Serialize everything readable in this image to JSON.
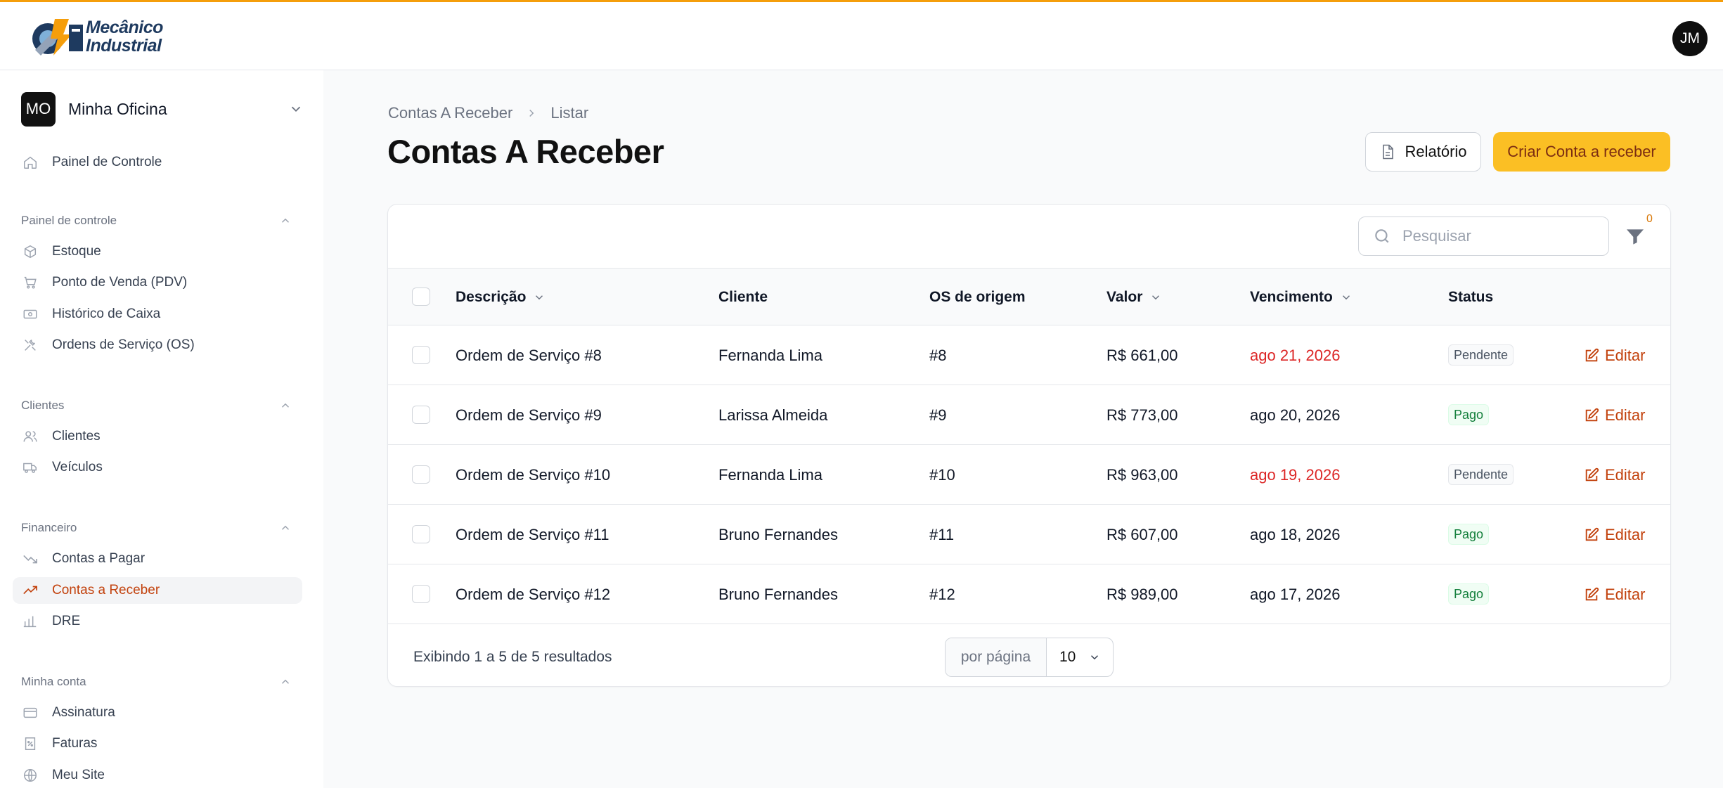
{
  "brand": {
    "line1": "Mecânico",
    "line2": "Industrial"
  },
  "user": {
    "initials": "JM"
  },
  "tenant": {
    "initials": "MO",
    "name": "Minha Oficina"
  },
  "sidebar": {
    "dashboard": "Painel de Controle",
    "groups": [
      {
        "label": "Painel de controle",
        "items": [
          "Estoque",
          "Ponto de Venda (PDV)",
          "Histórico de Caixa",
          "Ordens de Serviço (OS)"
        ]
      },
      {
        "label": "Clientes",
        "items": [
          "Clientes",
          "Veículos"
        ]
      },
      {
        "label": "Financeiro",
        "items": [
          "Contas a Pagar",
          "Contas a Receber",
          "DRE"
        ]
      },
      {
        "label": "Minha conta",
        "items": [
          "Assinatura",
          "Faturas",
          "Meu Site"
        ]
      }
    ],
    "active_item": "Contas a Receber"
  },
  "breadcrumb": {
    "parent": "Contas A Receber",
    "current": "Listar"
  },
  "page": {
    "title": "Contas A Receber"
  },
  "actions": {
    "report": "Relatório",
    "create": "Criar Conta a receber"
  },
  "search": {
    "placeholder": "Pesquisar"
  },
  "filter": {
    "count": "0"
  },
  "table": {
    "columns": [
      "Descrição",
      "Cliente",
      "OS de origem",
      "Valor",
      "Vencimento",
      "Status"
    ],
    "edit_label": "Editar",
    "rows": [
      {
        "descricao": "Ordem de Serviço #8",
        "cliente": "Fernanda Lima",
        "os": "#8",
        "valor": "R$ 661,00",
        "vencimento": "ago 21, 2026",
        "status": "Pendente"
      },
      {
        "descricao": "Ordem de Serviço #9",
        "cliente": "Larissa Almeida",
        "os": "#9",
        "valor": "R$ 773,00",
        "vencimento": "ago 20, 2026",
        "status": "Pago"
      },
      {
        "descricao": "Ordem de Serviço #10",
        "cliente": "Fernanda Lima",
        "os": "#10",
        "valor": "R$ 963,00",
        "vencimento": "ago 19, 2026",
        "status": "Pendente"
      },
      {
        "descricao": "Ordem de Serviço #11",
        "cliente": "Bruno Fernandes",
        "os": "#11",
        "valor": "R$ 607,00",
        "vencimento": "ago 18, 2026",
        "status": "Pago"
      },
      {
        "descricao": "Ordem de Serviço #12",
        "cliente": "Bruno Fernandes",
        "os": "#12",
        "valor": "R$ 989,00",
        "vencimento": "ago 17, 2026",
        "status": "Pago"
      }
    ]
  },
  "pagination": {
    "summary": "Exibindo 1 a 5 de 5 resultados",
    "per_page_label": "por página",
    "per_page_value": "10"
  },
  "colors": {
    "accent": "#fbbf24",
    "accent_text": "#c2410c",
    "overdue": "#dc2626",
    "paid": "#15803d"
  }
}
